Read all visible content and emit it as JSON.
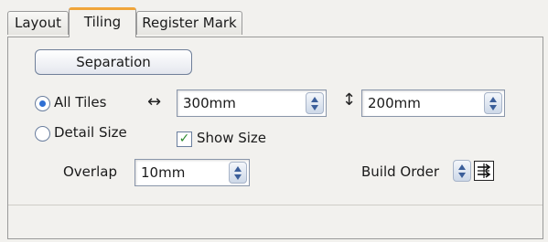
{
  "tabs": [
    {
      "label": "Layout",
      "active": false
    },
    {
      "label": "Tiling",
      "active": true
    },
    {
      "label": "Register Mark",
      "active": false
    }
  ],
  "separation_button": "Separation",
  "tiling_mode": {
    "all_tiles_label": "All Tiles",
    "detail_size_label": "Detail Size",
    "selected": "All Tiles"
  },
  "width_icon": "↔",
  "width_value": "300mm",
  "height_icon": "↕",
  "height_value": "200mm",
  "show_size": {
    "label": "Show Size",
    "checked": true,
    "check_glyph": "✓"
  },
  "overlap": {
    "label": "Overlap",
    "value": "10mm"
  },
  "build_order": {
    "label": "Build Order",
    "icon": "build-order-icon"
  },
  "colors": {
    "active_tab_accent": "#f0a53a",
    "radio_dot": "#2f6fd3",
    "check": "#2f8a2f"
  }
}
